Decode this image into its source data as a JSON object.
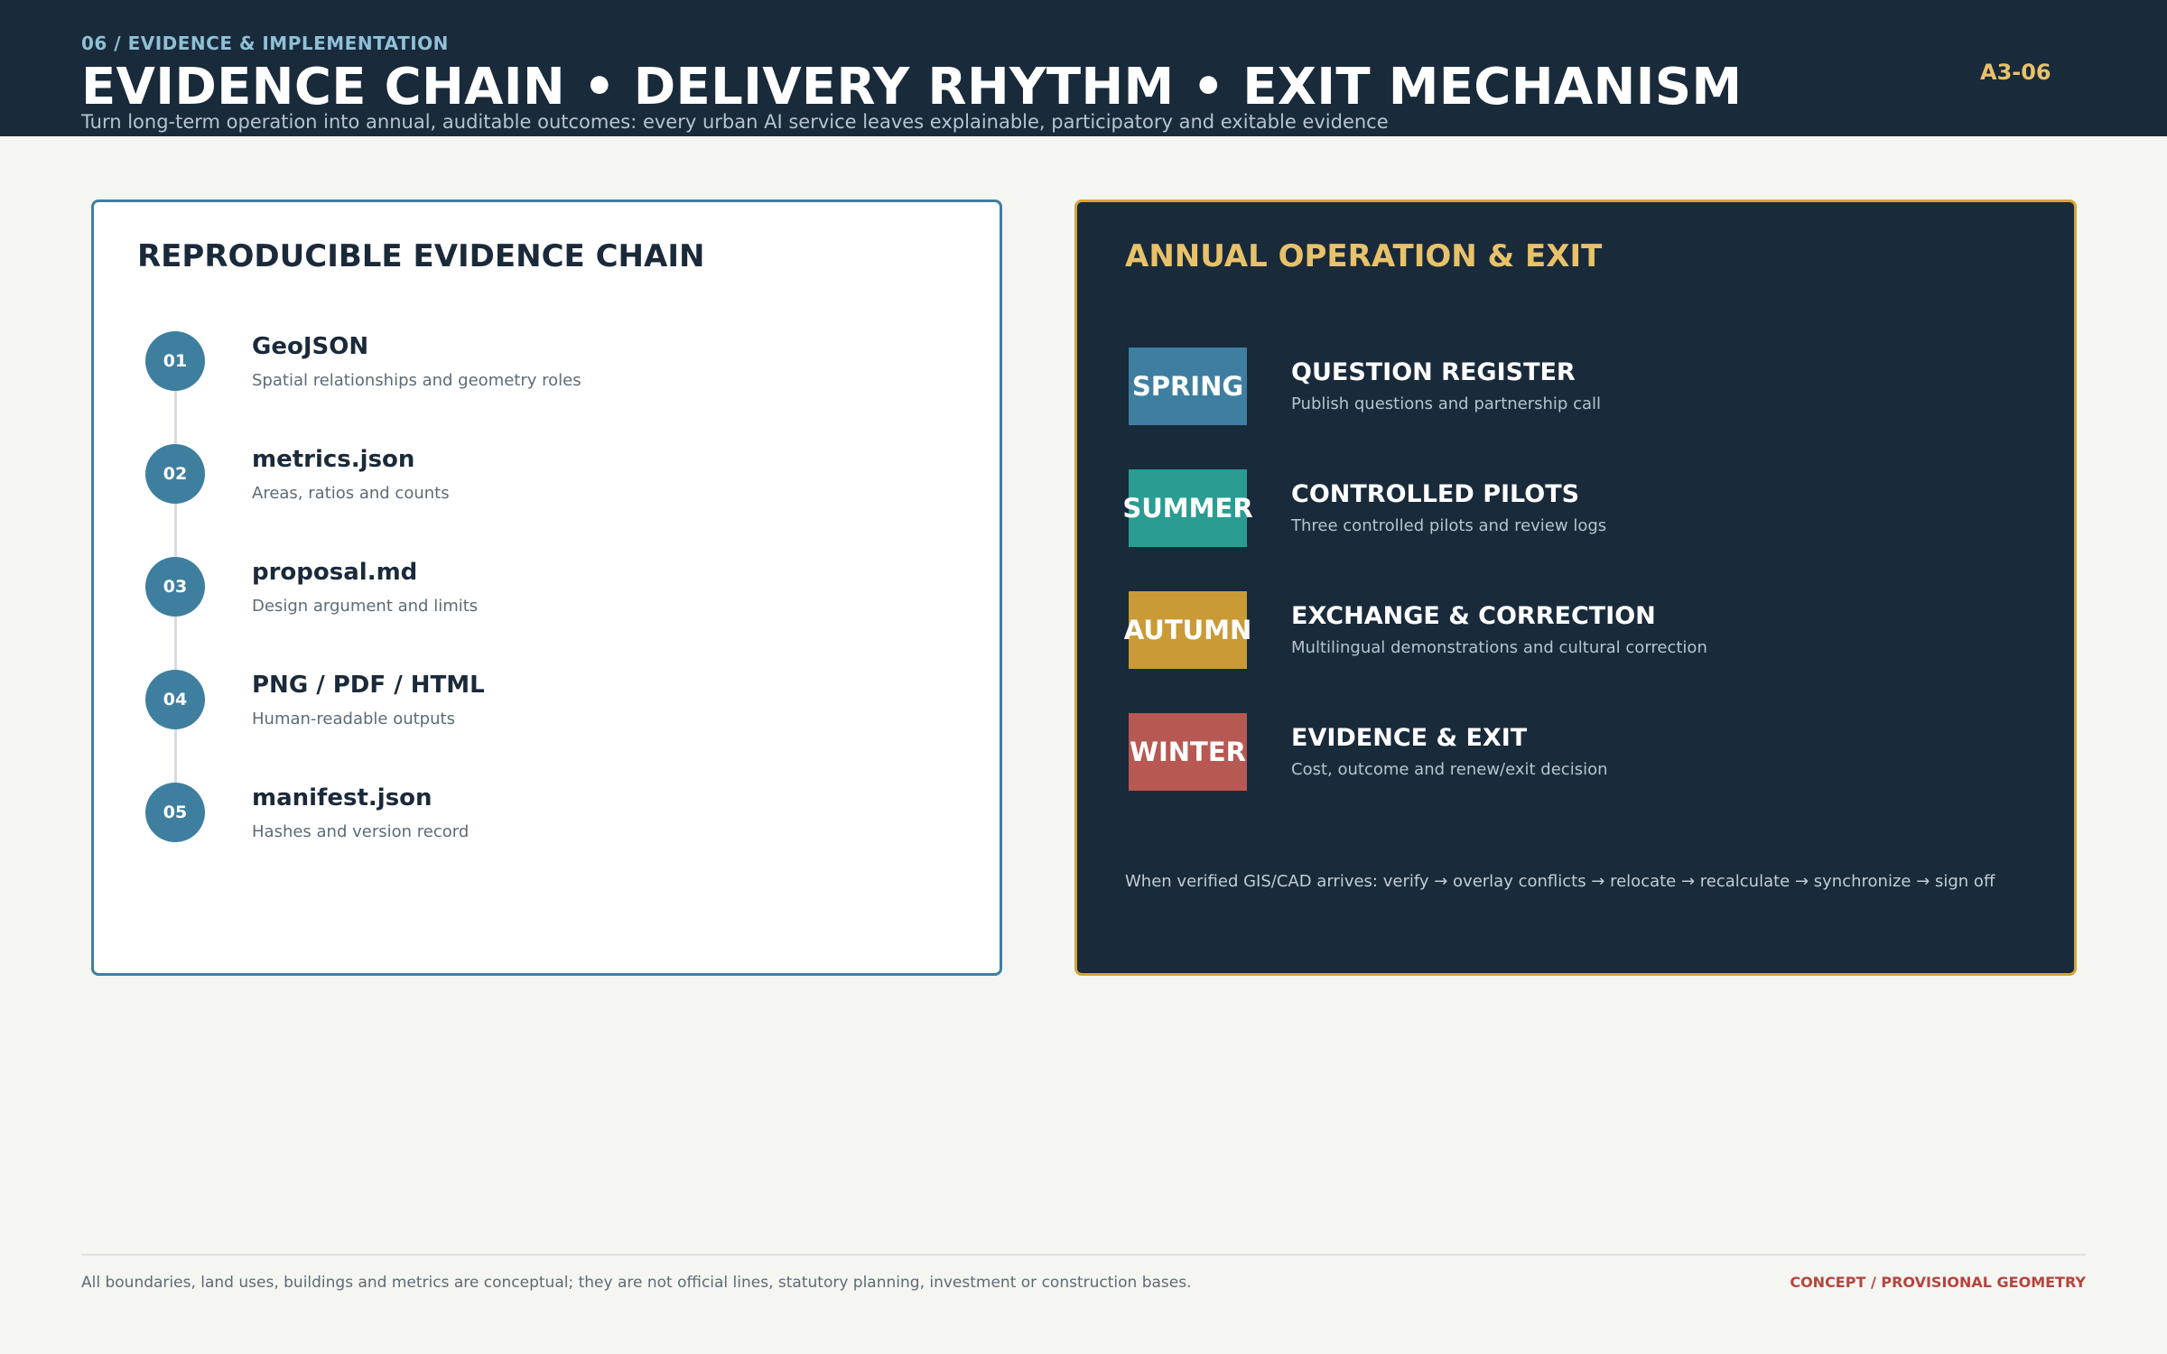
{
  "header": {
    "section_label": "06 / EVIDENCE & IMPLEMENTATION",
    "title": "EVIDENCE CHAIN • DELIVERY RHYTHM • EXIT MECHANISM",
    "subtitle": "Turn long-term operation into annual, auditable outcomes: every urban AI service leaves explainable, participatory and exitable evidence",
    "page_code": "A3-06"
  },
  "evidence_chain": {
    "title": "REPRODUCIBLE EVIDENCE CHAIN",
    "items": [
      {
        "num": "01",
        "name": "GeoJSON",
        "desc": "Spatial relationships and geometry roles"
      },
      {
        "num": "02",
        "name": "metrics.json",
        "desc": "Areas, ratios and counts"
      },
      {
        "num": "03",
        "name": "proposal.md",
        "desc": "Design argument and limits"
      },
      {
        "num": "04",
        "name": "PNG / PDF / HTML",
        "desc": "Human-readable outputs"
      },
      {
        "num": "05",
        "name": "manifest.json",
        "desc": "Hashes and version record"
      }
    ]
  },
  "annual_operation": {
    "title": "ANNUAL OPERATION & EXIT",
    "seasons": [
      {
        "season": "SPRING",
        "title": "QUESTION REGISTER",
        "desc": "Publish questions and partnership call",
        "color": "#3e7fa0"
      },
      {
        "season": "SUMMER",
        "title": "CONTROLLED PILOTS",
        "desc": "Three controlled pilots and review logs",
        "color": "#2a9c91"
      },
      {
        "season": "AUTUMN",
        "title": "EXCHANGE & CORRECTION",
        "desc": "Multilingual demonstrations and cultural correction",
        "color": "#c99a35"
      },
      {
        "season": "WINTER",
        "title": "EVIDENCE & EXIT",
        "desc": "Cost, outcome and renew/exit decision",
        "color": "#b85852"
      }
    ],
    "flow_note": "When verified GIS/CAD arrives: verify → overlay conflicts → relocate → recalculate → synchronize → sign off"
  },
  "footer": {
    "note": "All boundaries, land uses, buildings and metrics are conceptual; they are not official lines, statutory planning, investment or construction bases.",
    "tag": "CONCEPT / PROVISIONAL GEOMETRY"
  }
}
